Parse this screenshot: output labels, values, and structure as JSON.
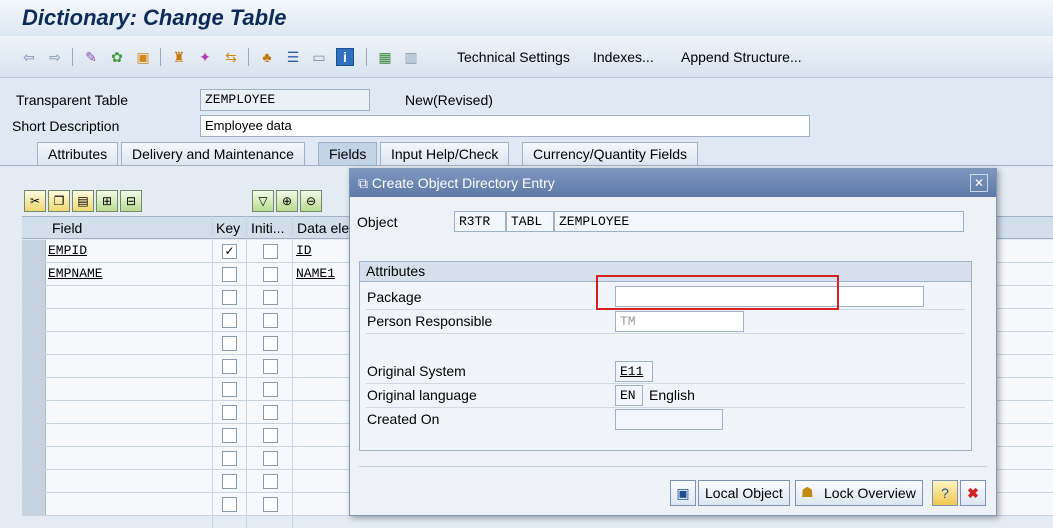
{
  "title": "Dictionary: Change Table",
  "toolbar": {
    "technical_settings": "Technical Settings",
    "indexes": "Indexes...",
    "append_structure": "Append Structure..."
  },
  "header": {
    "transparent_table_label": "Transparent Table",
    "table_name": "ZEMPLOYEE",
    "status": "New(Revised)",
    "short_description_label": "Short Description",
    "short_description": "Employee data"
  },
  "tabs": [
    {
      "label": "Attributes"
    },
    {
      "label": "Delivery and Maintenance"
    },
    {
      "label": "Fields"
    },
    {
      "label": "Input Help/Check"
    },
    {
      "label": "Currency/Quantity Fields"
    }
  ],
  "grid": {
    "headers": {
      "field": "Field",
      "key": "Key",
      "initial": "Initi...",
      "data_element": "Data ele"
    },
    "rows": [
      {
        "field": "EMPID",
        "key": true,
        "data_element": "ID"
      },
      {
        "field": "EMPNAME",
        "key": false,
        "data_element": "NAME1"
      }
    ]
  },
  "dialog": {
    "title": "Create Object Directory Entry",
    "object_label": "Object",
    "object_pgmid": "R3TR",
    "object_type": "TABL",
    "object_name": "ZEMPLOYEE",
    "attributes_label": "Attributes",
    "package_label": "Package",
    "package_value": "",
    "person_label": "Person Responsible",
    "person_value": "TM",
    "orig_system_label": "Original System",
    "orig_system_value": "E11",
    "orig_lang_label": "Original language",
    "orig_lang_code": "EN",
    "orig_lang_name": "English",
    "created_on_label": "Created On",
    "created_on_value": "",
    "local_object_label": "Local Object",
    "lock_overview_label": "Lock Overview"
  },
  "colors": {
    "title": "#0c2b58",
    "dialog_title_bg": "#5d79a7",
    "highlight": "#d42020"
  }
}
